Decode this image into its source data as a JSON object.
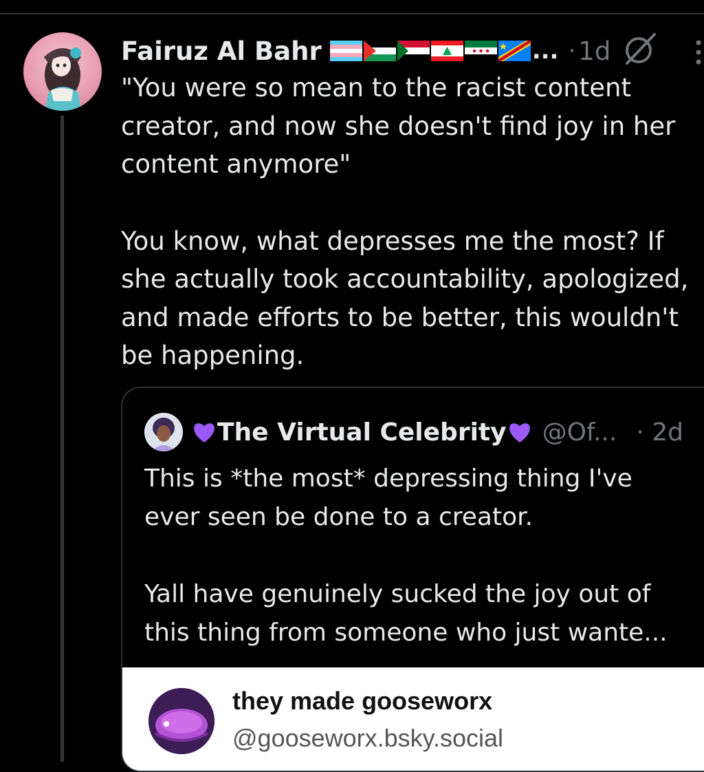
{
  "post": {
    "author_name": "Fairuz Al Bahr",
    "flags": [
      "transgender-flag",
      "palestine-flag",
      "sudan-flag",
      "lebanon-flag",
      "syria-flag",
      "congo-flag"
    ],
    "name_truncation": "...",
    "separator": "·",
    "time": "1d",
    "body_lines_1": [
      "\"You were so mean to the racist content",
      "creator, and now she doesn't find joy in her",
      "content anymore\""
    ],
    "body_lines_2": [
      "You know, what depresses me the most? If",
      "she actually took accountability, apologized,",
      "and made efforts to be better, this wouldn't",
      "be happening."
    ]
  },
  "quote": {
    "name": "The Virtual Celebrity",
    "handle": "@Of...",
    "time": "· 2d",
    "lines_1": [
      "This is *the most* depressing thing I've",
      "ever seen be done to a creator."
    ],
    "lines_2": [
      "Yall have genuinely sucked the joy out of",
      "this thing from someone who just wante..."
    ]
  },
  "embed": {
    "name": "they made gooseworx",
    "handle": "@gooseworx.bsky.social"
  },
  "colors": {
    "background": "#000000",
    "text": "#e7e9ea",
    "muted": "#71767b",
    "border": "#2f3336",
    "heart": "#9b59f5"
  }
}
